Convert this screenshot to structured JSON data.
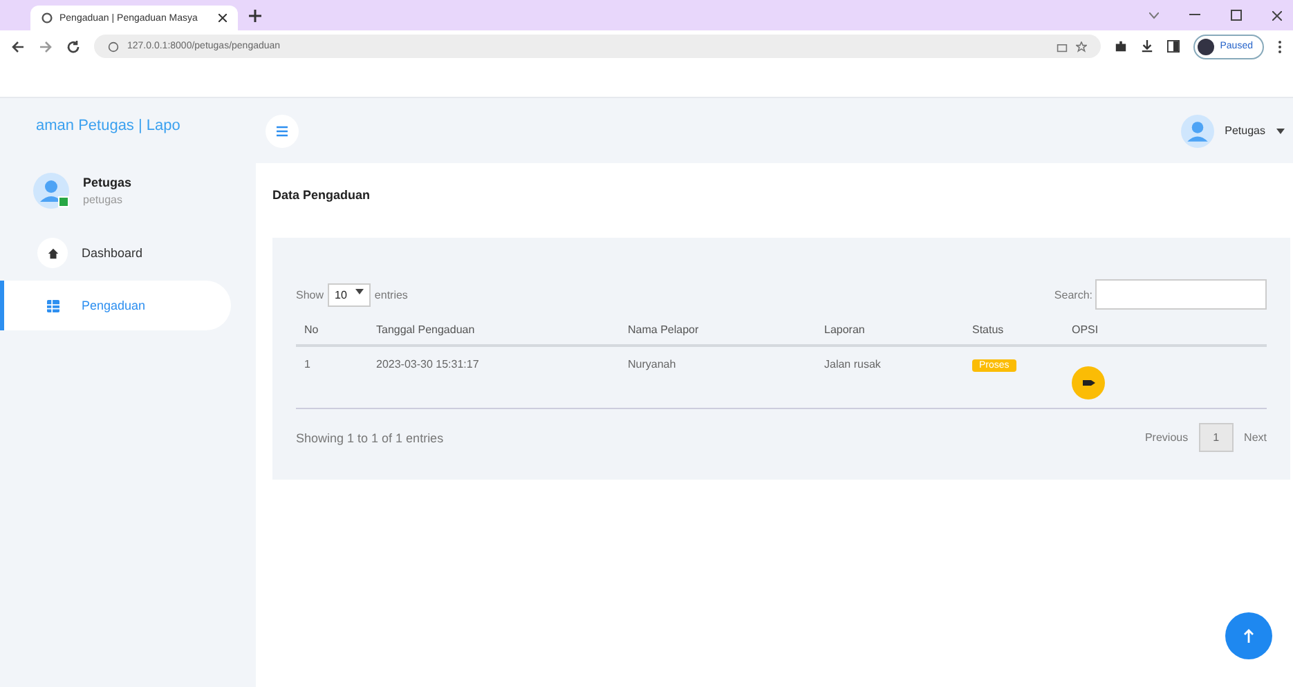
{
  "browser": {
    "tab_title": "Pengaduan | Pengaduan Masya",
    "url": "127.0.0.1:8000/petugas/pengaduan",
    "profile": "Paused"
  },
  "sidebar": {
    "brand": "aman Petugas | Lapo",
    "user": {
      "name": "Petugas",
      "role": "petugas",
      "online": true
    },
    "items": [
      {
        "label": "Dashboard",
        "selected": false
      },
      {
        "label": "Pengaduan",
        "selected": true
      }
    ]
  },
  "topbar": {
    "user": "Petugas"
  },
  "card": {
    "title": "Data Pengaduan",
    "length_label_before": "Show",
    "length_value": "10",
    "length_label_after": "entries",
    "search_label": "Search:",
    "columns": [
      "No",
      "Tanggal Pengaduan",
      "Nama Pelapor",
      "Laporan",
      "Status",
      "OPSI"
    ],
    "rows": [
      {
        "no": "1",
        "date": "2023-03-30 15:31:17",
        "name": "Nuryanah",
        "report": "Jalan rusak",
        "status": "Proses"
      }
    ],
    "info": "Showing 1 to 1 of 1 entries",
    "pagination": {
      "previous": "Previous",
      "pages": [
        {
          "label": "1",
          "selected": true
        }
      ],
      "next": "Next"
    }
  }
}
